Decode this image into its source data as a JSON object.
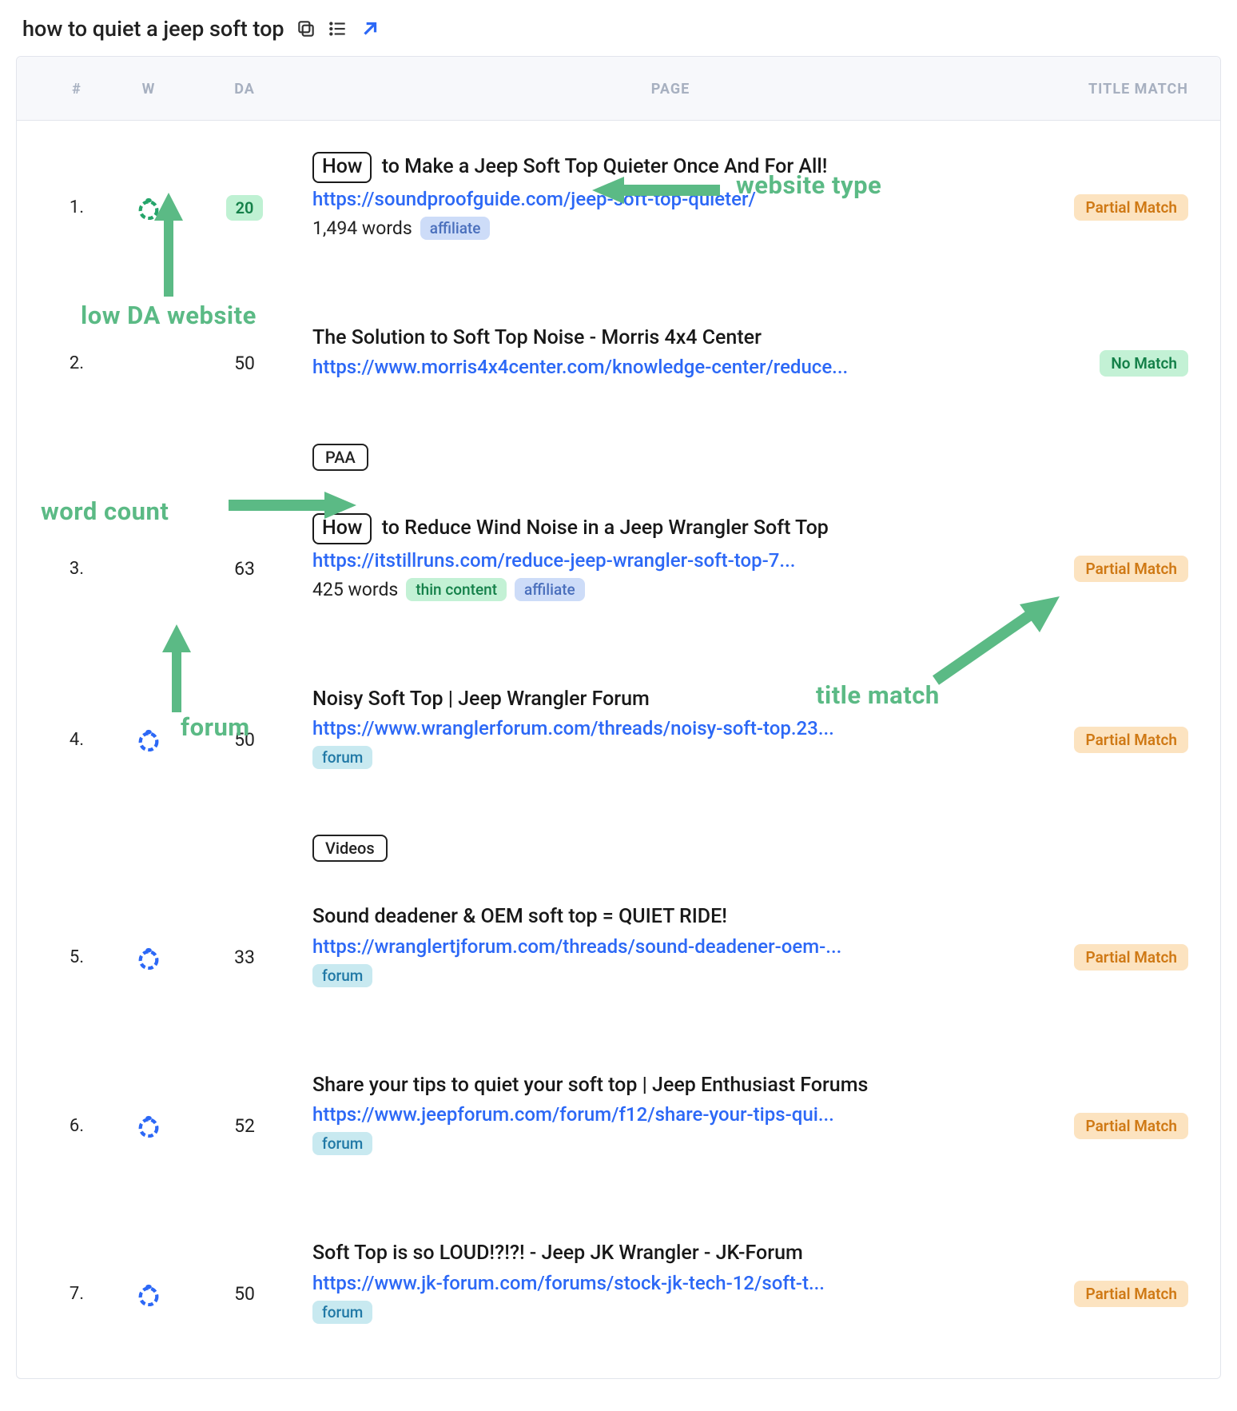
{
  "header": {
    "query": "how to quiet a jeep soft top"
  },
  "columns": {
    "rank": "#",
    "w": "W",
    "da": "DA",
    "page": "PAGE",
    "match": "TITLE MATCH"
  },
  "annotations": {
    "low_da": "low DA website",
    "website_type": "website type",
    "word_count": "word count",
    "forum": "forum",
    "title_match": "title match"
  },
  "sections": {
    "paa": "PAA",
    "videos": "Videos"
  },
  "rows": [
    {
      "rank": "1.",
      "has_ring": true,
      "ring_color": "green",
      "da": "20",
      "da_pill": true,
      "boxed": "How",
      "title": " to Make a Jeep Soft Top Quieter Once And For All!",
      "url": "https://soundproofguide.com/jeep-soft-top-quieter/",
      "words": "1,494 words",
      "tags": [
        {
          "text": "affiliate",
          "style": "blue"
        }
      ],
      "match": "Partial Match",
      "match_style": "partial"
    },
    {
      "rank": "2.",
      "has_ring": false,
      "da": "50",
      "title": "The Solution to Soft Top Noise - Morris 4x4 Center",
      "url": "https://www.morris4x4center.com/knowledge-center/reduce...",
      "match": "No Match",
      "match_style": "nomatch"
    },
    {
      "rank": "3.",
      "has_ring": false,
      "da": "63",
      "boxed": "How",
      "title": " to Reduce Wind Noise in a Jeep Wrangler Soft Top",
      "url": "https://itstillruns.com/reduce-jeep-wrangler-soft-top-7...",
      "words": "425 words",
      "tags": [
        {
          "text": "thin content",
          "style": "green"
        },
        {
          "text": "affiliate",
          "style": "blue"
        }
      ],
      "match": "Partial Match",
      "match_style": "partial"
    },
    {
      "rank": "4.",
      "has_ring": true,
      "ring_color": "blue",
      "da": "50",
      "title": "Noisy Soft Top | Jeep Wrangler Forum",
      "url": "https://www.wranglerforum.com/threads/noisy-soft-top.23...",
      "tags": [
        {
          "text": "forum",
          "style": "teal"
        }
      ],
      "match": "Partial Match",
      "match_style": "partial"
    },
    {
      "rank": "5.",
      "has_ring": true,
      "ring_color": "blue",
      "da": "33",
      "title": "Sound deadener & OEM soft top = QUIET RIDE!",
      "url": "https://wranglertjforum.com/threads/sound-deadener-oem-...",
      "tags": [
        {
          "text": "forum",
          "style": "teal"
        }
      ],
      "match": "Partial Match",
      "match_style": "partial"
    },
    {
      "rank": "6.",
      "has_ring": true,
      "ring_color": "blue",
      "da": "52",
      "title": "Share your tips to quiet your soft top | Jeep Enthusiast Forums",
      "url": "https://www.jeepforum.com/forum/f12/share-your-tips-qui...",
      "tags": [
        {
          "text": "forum",
          "style": "teal"
        }
      ],
      "match": "Partial Match",
      "match_style": "partial"
    },
    {
      "rank": "7.",
      "has_ring": true,
      "ring_color": "blue",
      "da": "50",
      "title": "Soft Top is so LOUD!?!?! - Jeep JK Wrangler - JK-Forum",
      "url": "https://www.jk-forum.com/forums/stock-jk-tech-12/soft-t...",
      "tags": [
        {
          "text": "forum",
          "style": "teal"
        }
      ],
      "match": "Partial Match",
      "match_style": "partial"
    }
  ]
}
